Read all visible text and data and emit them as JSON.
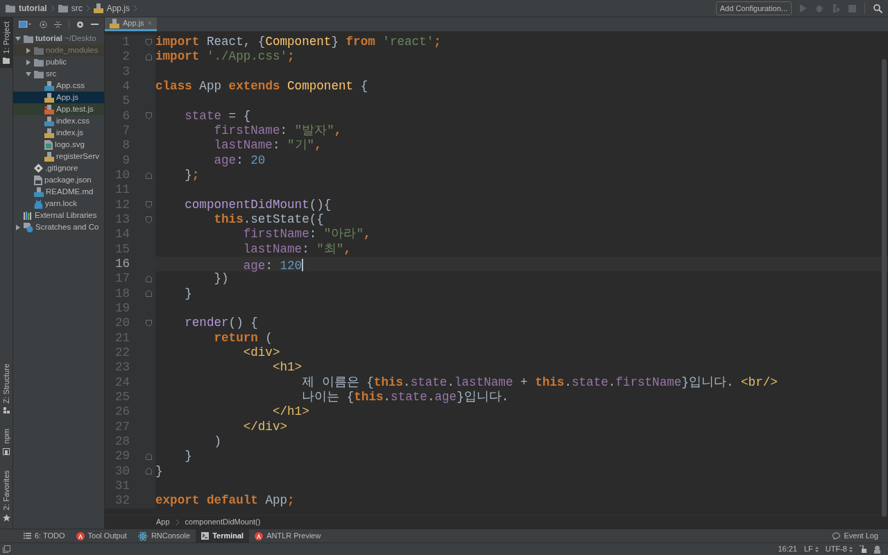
{
  "breadcrumbs": [
    {
      "label": "tutorial",
      "kind": "folder"
    },
    {
      "label": "src",
      "kind": "folder"
    },
    {
      "label": "App.js",
      "kind": "js"
    }
  ],
  "run_toolbar": {
    "config_button": "Add Configuration..."
  },
  "left_strip": {
    "top": [
      {
        "label": "1: Project",
        "kind": "project",
        "selected": true
      }
    ],
    "bottom": [
      {
        "label": "Z: Structure",
        "kind": "structure",
        "selected": false
      },
      {
        "label": "npm",
        "kind": "npm",
        "selected": false
      },
      {
        "label": "2: Favorites",
        "kind": "favorites",
        "selected": false
      }
    ]
  },
  "project_tree": [
    {
      "label": "tutorial",
      "secondary": "~/Deskto",
      "kind": "folder",
      "expanded": true,
      "selected": false,
      "children": [
        {
          "label": "node_modules",
          "kind": "excluded",
          "expanded": false,
          "selected": false
        },
        {
          "label": "public",
          "kind": "folder",
          "expanded": false,
          "selected": false
        },
        {
          "label": "src",
          "kind": "folder",
          "expanded": true,
          "selected": false,
          "children": [
            {
              "label": "App.css",
              "kind": "css",
              "selected": false
            },
            {
              "label": "App.js",
              "kind": "js",
              "selected": true
            },
            {
              "label": "App.test.js",
              "kind": "test",
              "selected": false
            },
            {
              "label": "index.css",
              "kind": "css",
              "selected": false
            },
            {
              "label": "index.js",
              "kind": "js",
              "selected": false
            },
            {
              "label": "logo.svg",
              "kind": "image",
              "selected": false
            },
            {
              "label": "registerServ",
              "kind": "js",
              "selected": false
            }
          ]
        },
        {
          "label": ".gitignore",
          "kind": "git",
          "selected": false
        },
        {
          "label": "package.json",
          "kind": "json",
          "selected": false
        },
        {
          "label": "README.md",
          "kind": "md",
          "selected": false
        },
        {
          "label": "yarn.lock",
          "kind": "yarn",
          "selected": false
        }
      ]
    },
    {
      "label": "External Libraries",
      "kind": "libraries",
      "selected": false
    },
    {
      "label": "Scratches and Co",
      "kind": "scratches",
      "expanded": false,
      "selected": false
    }
  ],
  "editor_tabs": [
    {
      "label": "App.js",
      "kind": "js",
      "selected": true,
      "close": "×"
    }
  ],
  "code_lines": [
    {
      "number": "1",
      "current": false,
      "kind": "fold-start",
      "tokens": [
        {
          "text": "import",
          "kind": "kw"
        },
        {
          "text": " React, {",
          "kind": "plain"
        },
        {
          "text": "Component",
          "kind": "cls"
        },
        {
          "text": "} ",
          "kind": "plain"
        },
        {
          "text": "from",
          "kind": "kw"
        },
        {
          "text": " 'react'",
          "kind": "str"
        },
        {
          "text": ";",
          "kind": "kw"
        }
      ]
    },
    {
      "number": "2",
      "current": false,
      "kind": "fold-end",
      "tokens": [
        {
          "text": "import",
          "kind": "kw"
        },
        {
          "text": " './App.css'",
          "kind": "str"
        },
        {
          "text": ";",
          "kind": "kw"
        }
      ]
    },
    {
      "number": "3",
      "current": false,
      "kind": "plain"
    },
    {
      "number": "4",
      "current": false,
      "kind": "plain",
      "tokens": [
        {
          "text": "class",
          "kind": "kw"
        },
        {
          "text": " App ",
          "kind": "plain"
        },
        {
          "text": "extends",
          "kind": "kw"
        },
        {
          "text": " Component",
          "kind": "cls"
        },
        {
          "text": " {",
          "kind": "plain"
        }
      ]
    },
    {
      "number": "5",
      "current": false,
      "kind": "plain"
    },
    {
      "number": "6",
      "current": false,
      "kind": "fold-start",
      "tokens": [
        {
          "text": "    state",
          "kind": "prop"
        },
        {
          "text": " = {",
          "kind": "plain"
        }
      ]
    },
    {
      "number": "7",
      "current": false,
      "kind": "plain",
      "tokens": [
        {
          "text": "        firstName",
          "kind": "prop"
        },
        {
          "text": ": ",
          "kind": "plain"
        },
        {
          "text": "\"발자\"",
          "kind": "str"
        },
        {
          "text": ",",
          "kind": "kw"
        }
      ]
    },
    {
      "number": "8",
      "current": false,
      "kind": "plain",
      "tokens": [
        {
          "text": "        lastName",
          "kind": "prop"
        },
        {
          "text": ": ",
          "kind": "plain"
        },
        {
          "text": "\"기\"",
          "kind": "str"
        },
        {
          "text": ",",
          "kind": "kw"
        }
      ]
    },
    {
      "number": "9",
      "current": false,
      "kind": "plain",
      "tokens": [
        {
          "text": "        age",
          "kind": "prop"
        },
        {
          "text": ": ",
          "kind": "plain"
        },
        {
          "text": "20",
          "kind": "num"
        }
      ]
    },
    {
      "number": "10",
      "current": false,
      "kind": "fold-end",
      "tokens": [
        {
          "text": "    }",
          "kind": "plain"
        },
        {
          "text": ";",
          "kind": "kw"
        }
      ]
    },
    {
      "number": "11",
      "current": false,
      "kind": "plain"
    },
    {
      "number": "12",
      "current": false,
      "kind": "fold-start",
      "tokens": [
        {
          "text": "    componentDidMount",
          "kind": "fn"
        },
        {
          "text": "(){",
          "kind": "plain"
        }
      ]
    },
    {
      "number": "13",
      "current": false,
      "kind": "fold-start",
      "tokens": [
        {
          "text": "        this",
          "kind": "kw"
        },
        {
          "text": ".setState({",
          "kind": "plain"
        }
      ]
    },
    {
      "number": "14",
      "current": false,
      "kind": "plain",
      "tokens": [
        {
          "text": "            firstName",
          "kind": "prop"
        },
        {
          "text": ": ",
          "kind": "plain"
        },
        {
          "text": "\"아라\"",
          "kind": "str"
        },
        {
          "text": ",",
          "kind": "kw"
        }
      ]
    },
    {
      "number": "15",
      "current": false,
      "kind": "plain",
      "tokens": [
        {
          "text": "            lastName",
          "kind": "prop"
        },
        {
          "text": ": ",
          "kind": "plain"
        },
        {
          "text": "\"최\"",
          "kind": "str"
        },
        {
          "text": ",",
          "kind": "kw"
        }
      ]
    },
    {
      "number": "16",
      "current": true,
      "kind": "plain",
      "tokens": [
        {
          "text": "            age",
          "kind": "prop"
        },
        {
          "text": ": ",
          "kind": "plain"
        },
        {
          "text": "120",
          "kind": "num"
        }
      ]
    },
    {
      "number": "17",
      "current": false,
      "kind": "fold-end",
      "tokens": [
        {
          "text": "        })",
          "kind": "plain"
        }
      ]
    },
    {
      "number": "18",
      "current": false,
      "kind": "fold-end",
      "tokens": [
        {
          "text": "    }",
          "kind": "plain"
        }
      ]
    },
    {
      "number": "19",
      "current": false,
      "kind": "plain"
    },
    {
      "number": "20",
      "current": false,
      "kind": "fold-start",
      "tokens": [
        {
          "text": "    render",
          "kind": "fn"
        },
        {
          "text": "() {",
          "kind": "plain"
        }
      ]
    },
    {
      "number": "21",
      "current": false,
      "kind": "plain",
      "tokens": [
        {
          "text": "        return",
          "kind": "kw"
        },
        {
          "text": " (",
          "kind": "plain"
        }
      ]
    },
    {
      "number": "22",
      "current": false,
      "kind": "plain",
      "tokens": [
        {
          "text": "            <div>",
          "kind": "tag"
        }
      ]
    },
    {
      "number": "23",
      "current": false,
      "kind": "plain",
      "tokens": [
        {
          "text": "                <h1>",
          "kind": "tag"
        }
      ]
    },
    {
      "number": "24",
      "current": false,
      "kind": "plain",
      "tokens": [
        {
          "text": "                    제 이름은 {",
          "kind": "plain"
        },
        {
          "text": "this",
          "kind": "kw"
        },
        {
          "text": ".",
          "kind": "plain"
        },
        {
          "text": "state",
          "kind": "prop"
        },
        {
          "text": ".",
          "kind": "plain"
        },
        {
          "text": "lastName",
          "kind": "prop"
        },
        {
          "text": " + ",
          "kind": "plain"
        },
        {
          "text": "this",
          "kind": "kw"
        },
        {
          "text": ".",
          "kind": "plain"
        },
        {
          "text": "state",
          "kind": "prop"
        },
        {
          "text": ".",
          "kind": "plain"
        },
        {
          "text": "firstName",
          "kind": "prop"
        },
        {
          "text": "}입니다. ",
          "kind": "plain"
        },
        {
          "text": "<br/>",
          "kind": "tag"
        }
      ]
    },
    {
      "number": "25",
      "current": false,
      "kind": "plain",
      "tokens": [
        {
          "text": "                    나이는 {",
          "kind": "plain"
        },
        {
          "text": "this",
          "kind": "kw"
        },
        {
          "text": ".",
          "kind": "plain"
        },
        {
          "text": "state",
          "kind": "prop"
        },
        {
          "text": ".",
          "kind": "plain"
        },
        {
          "text": "age",
          "kind": "prop"
        },
        {
          "text": "}입니다.",
          "kind": "plain"
        }
      ]
    },
    {
      "number": "26",
      "current": false,
      "kind": "plain",
      "tokens": [
        {
          "text": "                </h1>",
          "kind": "tag"
        }
      ]
    },
    {
      "number": "27",
      "current": false,
      "kind": "plain",
      "tokens": [
        {
          "text": "            </div>",
          "kind": "tag"
        }
      ]
    },
    {
      "number": "28",
      "current": false,
      "kind": "plain",
      "tokens": [
        {
          "text": "        )",
          "kind": "plain"
        }
      ]
    },
    {
      "number": "29",
      "current": false,
      "kind": "fold-end",
      "tokens": [
        {
          "text": "    }",
          "kind": "plain"
        }
      ]
    },
    {
      "number": "30",
      "current": false,
      "kind": "fold-end",
      "tokens": [
        {
          "text": "}",
          "kind": "plain"
        }
      ]
    },
    {
      "number": "31",
      "current": false,
      "kind": "plain"
    },
    {
      "number": "32",
      "current": false,
      "kind": "plain",
      "tokens": [
        {
          "text": "export",
          "kind": "kw"
        },
        {
          "text": " default",
          "kind": "kw"
        },
        {
          "text": " App",
          "kind": "plain"
        },
        {
          "text": ";",
          "kind": "kw"
        }
      ]
    }
  ],
  "editor_breadcrumbs": [
    "App",
    "componentDidMount()"
  ],
  "tool_windows": [
    {
      "label": "6: TODO",
      "kind": "todo",
      "selected": false
    },
    {
      "label": "Tool Output",
      "kind": "antlr",
      "selected": false
    },
    {
      "label": "RNConsole",
      "kind": "react",
      "selected": false
    },
    {
      "label": "Terminal",
      "kind": "terminal",
      "selected": true
    },
    {
      "label": "ANTLR Preview",
      "kind": "antlr",
      "selected": false
    }
  ],
  "event_log": "Event Log",
  "status_bar": {
    "position": "16:21",
    "line_separator": "LF",
    "encoding": "UTF-8"
  }
}
